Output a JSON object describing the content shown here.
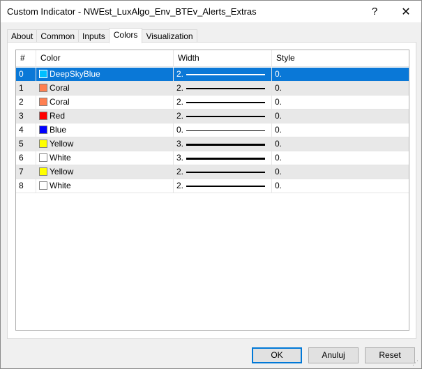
{
  "window": {
    "title": "Custom Indicator - NWEst_LuxAlgo_Env_BTEv_Alerts_Extras",
    "help_glyph": "?",
    "close_glyph": "✕"
  },
  "tabs": [
    {
      "label": "About",
      "active": false
    },
    {
      "label": "Common",
      "active": false
    },
    {
      "label": "Inputs",
      "active": false
    },
    {
      "label": "Colors",
      "active": true
    },
    {
      "label": "Visualization",
      "active": false
    }
  ],
  "grid": {
    "headers": {
      "index": "#",
      "color": "Color",
      "width": "Width",
      "style": "Style"
    },
    "rows": [
      {
        "index": "0",
        "color_name": "DeepSkyBlue",
        "swatch": "#00bfff",
        "width": "2.",
        "style": "0.",
        "selected": true
      },
      {
        "index": "1",
        "color_name": "Coral",
        "swatch": "#ff7f50",
        "width": "2.",
        "style": "0.",
        "selected": false
      },
      {
        "index": "2",
        "color_name": "Coral",
        "swatch": "#ff7f50",
        "width": "2.",
        "style": "0.",
        "selected": false
      },
      {
        "index": "3",
        "color_name": "Red",
        "swatch": "#ff0000",
        "width": "2.",
        "style": "0.",
        "selected": false
      },
      {
        "index": "4",
        "color_name": "Blue",
        "swatch": "#0000ff",
        "width": "0.",
        "style": "0.",
        "selected": false
      },
      {
        "index": "5",
        "color_name": "Yellow",
        "swatch": "#ffff00",
        "width": "3.",
        "style": "0.",
        "selected": false
      },
      {
        "index": "6",
        "color_name": "White",
        "swatch": "#ffffff",
        "width": "3.",
        "style": "0.",
        "selected": false
      },
      {
        "index": "7",
        "color_name": "Yellow",
        "swatch": "#ffff00",
        "width": "2.",
        "style": "0.",
        "selected": false
      },
      {
        "index": "8",
        "color_name": "White",
        "swatch": "#ffffff",
        "width": "2.",
        "style": "0.",
        "selected": false
      }
    ]
  },
  "buttons": {
    "ok": "OK",
    "cancel": "Anuluj",
    "reset": "Reset"
  },
  "colors": {
    "selection": "#0a78d7",
    "alt_row": "#e8e8e8"
  }
}
